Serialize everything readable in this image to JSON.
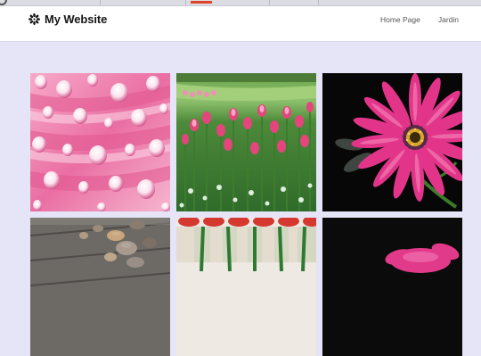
{
  "brand": {
    "name": "My Website",
    "icon": "flower-icon"
  },
  "nav": {
    "items": [
      {
        "label": "Home Page"
      },
      {
        "label": "Jardin"
      }
    ]
  },
  "gallery": {
    "photos": [
      {
        "subject": "pink petals with water droplets"
      },
      {
        "subject": "field of pink tulips"
      },
      {
        "subject": "pink daisy on black background"
      },
      {
        "subject": "pebble footprint on wooden boards"
      },
      {
        "subject": "row of red tulips"
      },
      {
        "subject": "pink flower on dark background"
      }
    ]
  },
  "colors": {
    "page_background": "#e6e4f7",
    "navbar_background": "#ffffff",
    "active_tab_indicator": "#e0452a"
  }
}
